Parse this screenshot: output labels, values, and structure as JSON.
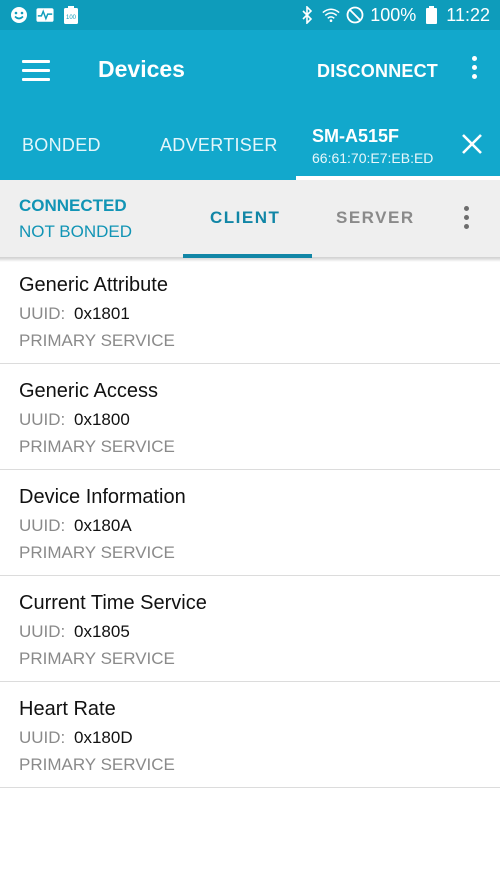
{
  "status_bar": {
    "battery_pct": "100%",
    "time": "11:22",
    "left_icons": [
      "smiley-icon",
      "activity-icon",
      "battery-100-icon"
    ],
    "right_icons": [
      "bluetooth-icon",
      "wifi-icon",
      "do-not-disturb-icon",
      "battery-icon"
    ]
  },
  "app_bar": {
    "title": "Devices",
    "disconnect_label": "DISCONNECT"
  },
  "tabs": {
    "bonded": "BONDED",
    "advertiser": "ADVERTISER",
    "device": {
      "name": "SM-A515F",
      "mac": "66:61:70:E7:EB:ED"
    }
  },
  "connection": {
    "status": "CONNECTED",
    "bond": "NOT BONDED"
  },
  "sub_tabs": {
    "client": "CLIENT",
    "server": "SERVER"
  },
  "services": [
    {
      "name": "Generic Attribute",
      "uuid_label": "UUID:",
      "uuid": "0x1801",
      "type": "PRIMARY SERVICE"
    },
    {
      "name": "Generic Access",
      "uuid_label": "UUID:",
      "uuid": "0x1800",
      "type": "PRIMARY SERVICE"
    },
    {
      "name": "Device Information",
      "uuid_label": "UUID:",
      "uuid": "0x180A",
      "type": "PRIMARY SERVICE"
    },
    {
      "name": "Current Time Service",
      "uuid_label": "UUID:",
      "uuid": "0x1805",
      "type": "PRIMARY SERVICE"
    },
    {
      "name": "Heart Rate",
      "uuid_label": "UUID:",
      "uuid": "0x180D",
      "type": "PRIMARY SERVICE"
    }
  ],
  "colors": {
    "status_bar": "#0e9cbb",
    "app_bar": "#12a8cc",
    "accent": "#1186a6"
  }
}
